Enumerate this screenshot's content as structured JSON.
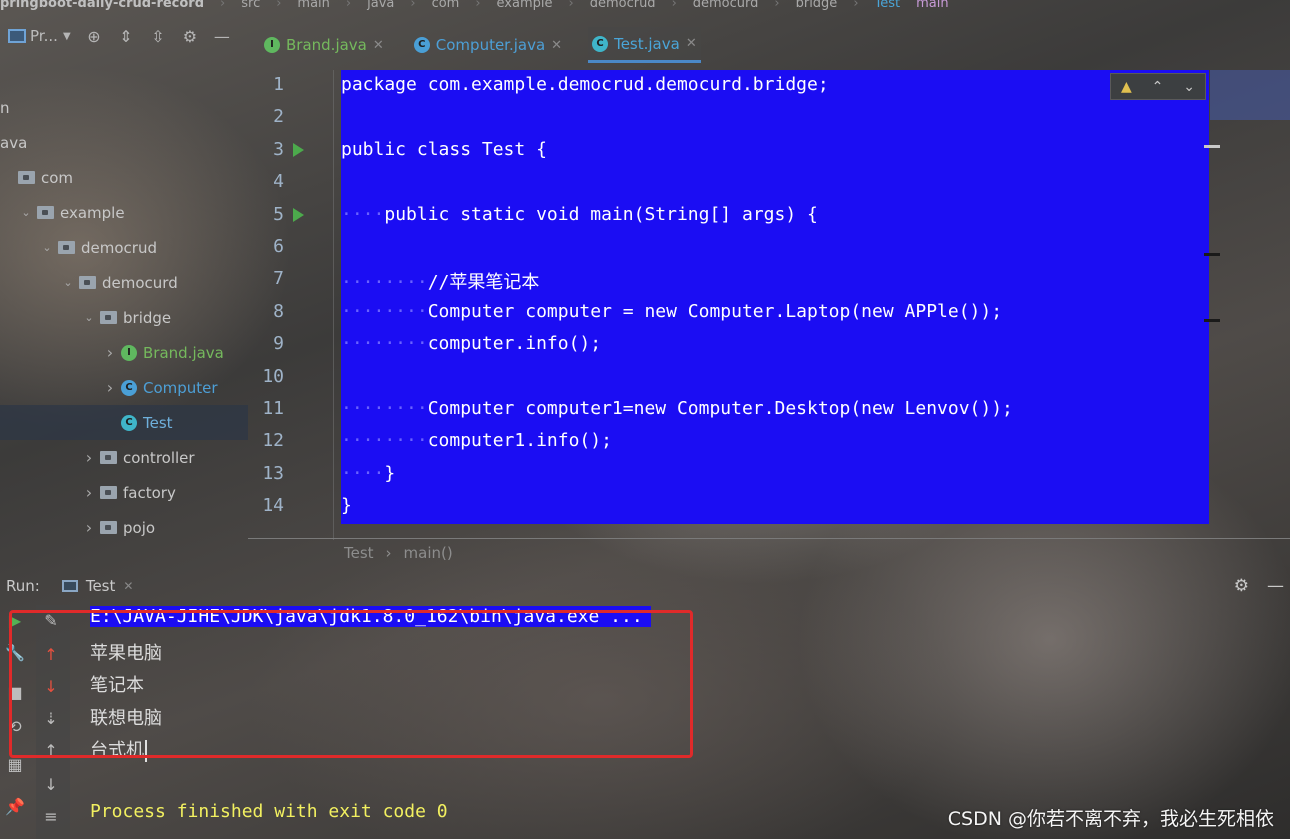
{
  "breadcrumb": {
    "project": "pringboot-daily-crud-record",
    "parts": [
      "src",
      "main",
      "java",
      "com",
      "example",
      "democrud",
      "democurd",
      "bridge"
    ],
    "file": "Test",
    "method": "main"
  },
  "project_panel": {
    "title": "Pr...",
    "tree": [
      {
        "label": "n",
        "type": "text",
        "indent": 0
      },
      {
        "label": "ava",
        "type": "text",
        "indent": 0
      },
      {
        "label": "com",
        "type": "folder",
        "indent": 0,
        "chevron": ""
      },
      {
        "label": "example",
        "type": "folder",
        "indent": 1,
        "chevron": "v"
      },
      {
        "label": "democrud",
        "type": "folder",
        "indent": 2,
        "chevron": "v"
      },
      {
        "label": "democurd",
        "type": "folder",
        "indent": 3,
        "chevron": "v"
      },
      {
        "label": "bridge",
        "type": "folder",
        "indent": 4,
        "chevron": "v"
      },
      {
        "label": "Brand.java",
        "type": "interface",
        "indent": 5,
        "chevron": ">"
      },
      {
        "label": "Computer",
        "type": "class",
        "indent": 5,
        "chevron": ">"
      },
      {
        "label": "Test",
        "type": "test",
        "indent": 5,
        "chevron": "",
        "selected": true
      },
      {
        "label": "controller",
        "type": "folder",
        "indent": 4,
        "chevron": ">"
      },
      {
        "label": "factory",
        "type": "folder",
        "indent": 4,
        "chevron": ">"
      },
      {
        "label": "pojo",
        "type": "folder",
        "indent": 4,
        "chevron": ">"
      }
    ]
  },
  "tabs": [
    {
      "label": "Brand.java",
      "kind": "interface"
    },
    {
      "label": "Computer.java",
      "kind": "class"
    },
    {
      "label": "Test.java",
      "kind": "test",
      "active": true
    }
  ],
  "editor": {
    "lines": [
      {
        "n": "1",
        "indent": 0,
        "text": "package com.example.democrud.democurd.bridge;"
      },
      {
        "n": "2",
        "indent": 0,
        "text": ""
      },
      {
        "n": "3",
        "indent": 0,
        "text": "public class Test {",
        "run": true
      },
      {
        "n": "4",
        "indent": 0,
        "text": ""
      },
      {
        "n": "5",
        "indent": 1,
        "text": "public static void main(String[] args) {",
        "run": true
      },
      {
        "n": "6",
        "indent": 0,
        "text": ""
      },
      {
        "n": "7",
        "indent": 2,
        "text": "//苹果笔记本"
      },
      {
        "n": "8",
        "indent": 2,
        "text": "Computer computer = new Computer.Laptop(new APPle());"
      },
      {
        "n": "9",
        "indent": 2,
        "text": "computer.info();"
      },
      {
        "n": "10",
        "indent": 0,
        "text": ""
      },
      {
        "n": "11",
        "indent": 2,
        "text": "Computer computer1=new Computer.Desktop(new Lenvov());"
      },
      {
        "n": "12",
        "indent": 2,
        "text": "computer1.info();"
      },
      {
        "n": "13",
        "indent": 1,
        "text": "}"
      },
      {
        "n": "14",
        "indent": 0,
        "text": "}"
      }
    ],
    "inspection": {
      "warn_icon": "warning-icon",
      "up": "^",
      "down": "v"
    },
    "footer_crumb": [
      "Test",
      "main()"
    ]
  },
  "run_panel": {
    "label": "Run:",
    "tab": "Test",
    "console": [
      {
        "text": "E:\\JAVA-JIHE\\JDK\\java\\jdk1.8.0_162\\bin\\java.exe ...",
        "kind": "cmd"
      },
      {
        "text": "苹果电脑",
        "kind": "out"
      },
      {
        "text": "笔记本",
        "kind": "out"
      },
      {
        "text": "联想电脑",
        "kind": "out"
      },
      {
        "text": "台式机",
        "kind": "out"
      },
      {
        "text": "",
        "kind": "blank"
      },
      {
        "text": "Process finished with exit code 0",
        "kind": "exit"
      }
    ]
  },
  "watermark": "CSDN @你若不离不弃，我必生死相依",
  "colors": {
    "selection": "#1b0df3",
    "highlight_box": "#e02a2a",
    "exit_text": "#f2f060",
    "run_green": "#4caa4c"
  }
}
